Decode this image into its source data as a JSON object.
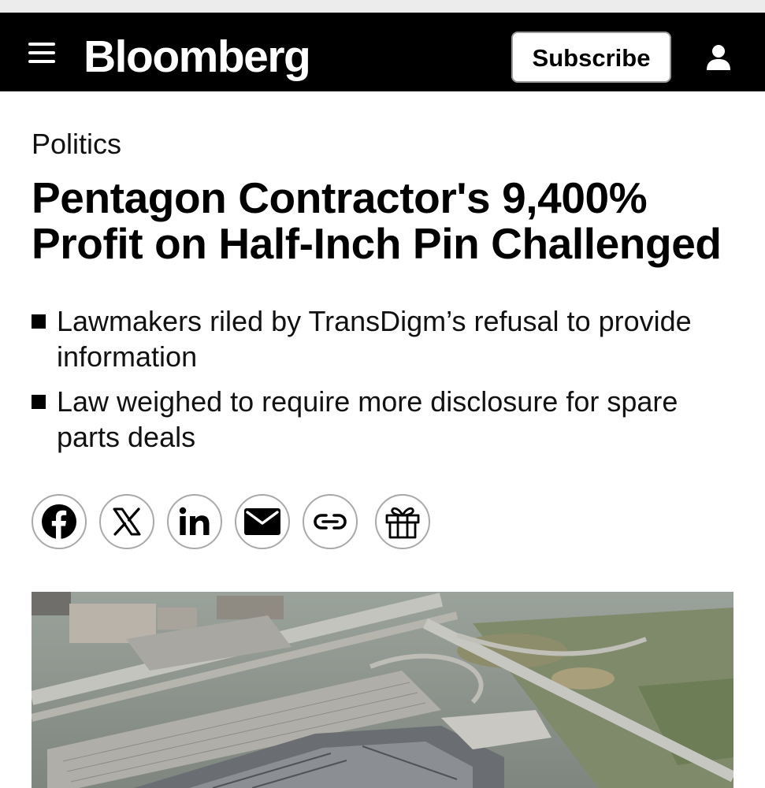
{
  "header": {
    "logo": "Bloomberg",
    "subscribe_label": "Subscribe"
  },
  "article": {
    "category": "Politics",
    "headline": "Pentagon Contractor's 9,400% Profit on Half-Inch Pin Challenged",
    "bullets": [
      "Lawmakers riled by TransDigm’s refusal to provide information",
      "Law weighed to require more disclosure for spare parts deals"
    ]
  },
  "share": {
    "buttons": [
      "facebook-icon",
      "x-icon",
      "linkedin-icon",
      "email-icon",
      "link-icon",
      "gift-icon"
    ]
  },
  "hero_image": {
    "subject": "aerial-photo-pentagon"
  },
  "colors": {
    "header_bg": "#000000",
    "text": "#000000",
    "button_border": "#a9a9a9"
  }
}
